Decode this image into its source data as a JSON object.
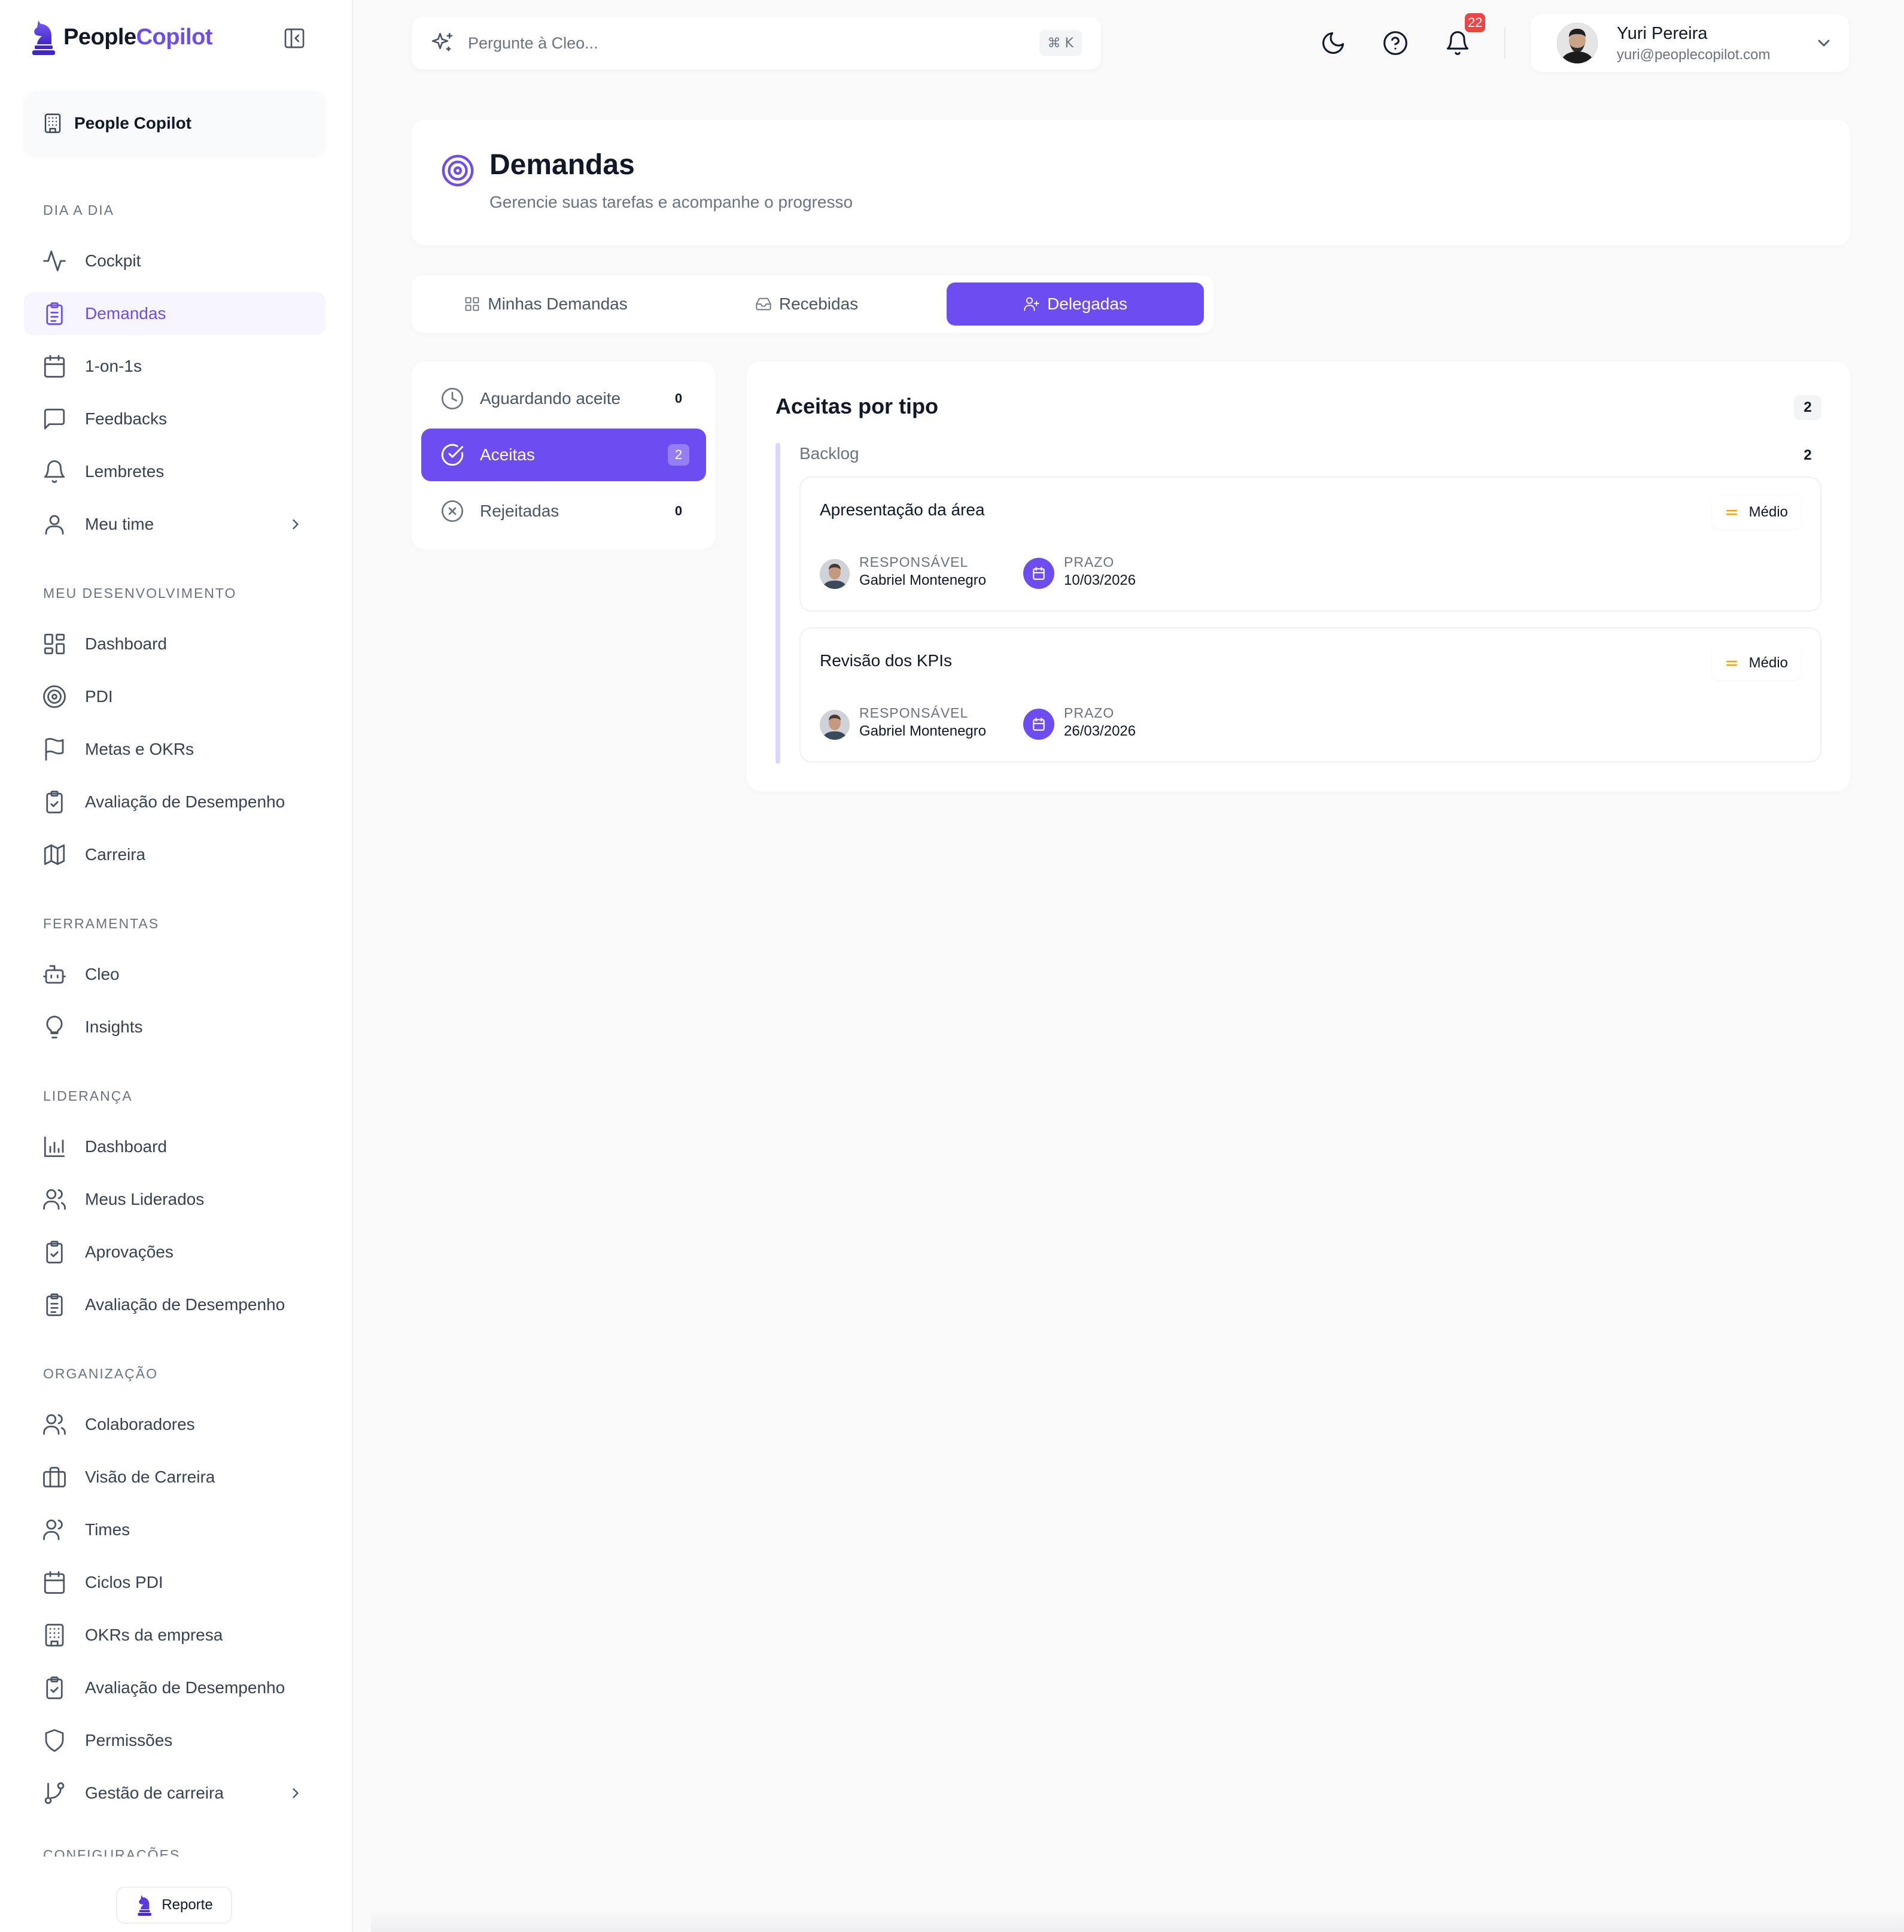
{
  "brand": {
    "name_part1": "People",
    "name_part2": "Copilot"
  },
  "org": {
    "label": "People Copilot"
  },
  "sections": {
    "dia_a_dia": "DIA A DIA",
    "meu_desenvolvimento": "MEU DESENVOLVIMENTO",
    "ferramentas": "FERRAMENTAS",
    "lideranca": "LIDERANÇA",
    "organizacao": "ORGANIZAÇÃO",
    "configuracoes": "CONFIGURAÇÕES"
  },
  "nav": {
    "dia_a_dia": [
      {
        "label": "Cockpit",
        "icon": "activity-icon"
      },
      {
        "label": "Demandas",
        "icon": "clipboard-list-icon",
        "active": true
      },
      {
        "label": "1-on-1s",
        "icon": "calendar-icon"
      },
      {
        "label": "Feedbacks",
        "icon": "message-square-icon"
      },
      {
        "label": "Lembretes",
        "icon": "bell-icon"
      },
      {
        "label": "Meu time",
        "icon": "user-icon"
      }
    ],
    "meu_desenvolvimento": [
      {
        "label": "Dashboard",
        "icon": "layout-grid-icon"
      },
      {
        "label": "PDI",
        "icon": "target-icon"
      },
      {
        "label": "Metas e OKRs",
        "icon": "flag-icon"
      },
      {
        "label": "Avaliação de Desempenho",
        "icon": "clipboard-check-icon"
      },
      {
        "label": "Carreira",
        "icon": "map-icon"
      }
    ],
    "ferramentas": [
      {
        "label": "Cleo",
        "icon": "bot-icon"
      },
      {
        "label": "Insights",
        "icon": "lightbulb-icon"
      }
    ],
    "lideranca": [
      {
        "label": "Dashboard",
        "icon": "bar-chart-icon"
      },
      {
        "label": "Meus Liderados",
        "icon": "users-icon"
      },
      {
        "label": "Aprovações",
        "icon": "clipboard-check-icon"
      },
      {
        "label": "Avaliação de Desempenho",
        "icon": "clipboard-list-icon"
      }
    ],
    "organizacao": [
      {
        "label": "Colaboradores",
        "icon": "users-icon"
      },
      {
        "label": "Visão de Carreira",
        "icon": "briefcase-icon"
      },
      {
        "label": "Times",
        "icon": "users-icon"
      },
      {
        "label": "Ciclos PDI",
        "icon": "calendar-icon"
      },
      {
        "label": "OKRs da empresa",
        "icon": "building-icon"
      },
      {
        "label": "Avaliação de Desempenho",
        "icon": "clipboard-check-icon"
      },
      {
        "label": "Permissões",
        "icon": "shield-icon"
      },
      {
        "label": "Gestão de carreira",
        "icon": "git-branch-icon"
      }
    ]
  },
  "report": {
    "label": "Reporte"
  },
  "search": {
    "placeholder": "Pergunte à Cleo...",
    "shortcut": "⌘ K"
  },
  "notifications": {
    "count": "22"
  },
  "user": {
    "name": "Yuri Pereira",
    "email": "yuri@peoplecopilot.com"
  },
  "page": {
    "title": "Demandas",
    "subtitle": "Gerencie suas tarefas e acompanhe o progresso"
  },
  "tabs": [
    {
      "label": "Minhas Demandas",
      "icon": "layout-grid-icon"
    },
    {
      "label": "Recebidas",
      "icon": "inbox-icon"
    },
    {
      "label": "Delegadas",
      "icon": "user-plus-icon",
      "active": true
    }
  ],
  "status_filters": [
    {
      "label": "Aguardando aceite",
      "count": "0",
      "icon": "clock-icon"
    },
    {
      "label": "Aceitas",
      "count": "2",
      "icon": "check-circle-icon",
      "active": true
    },
    {
      "label": "Rejeitadas",
      "count": "0",
      "icon": "x-circle-icon"
    }
  ],
  "panel": {
    "title": "Aceitas por tipo",
    "total": "2",
    "group": {
      "name": "Backlog",
      "count": "2"
    },
    "tasks": [
      {
        "title": "Apresentação da área",
        "priority": "Médio",
        "responsavel_label": "RESPONSÁVEL",
        "responsavel": "Gabriel Montenegro",
        "prazo_label": "PRAZO",
        "prazo": "10/03/2026"
      },
      {
        "title": "Revisão dos KPIs",
        "priority": "Médio",
        "responsavel_label": "RESPONSÁVEL",
        "responsavel": "Gabriel Montenegro",
        "prazo_label": "PRAZO",
        "prazo": "26/03/2026"
      }
    ]
  },
  "colors": {
    "accent": "#6d4cf0",
    "badge": "#ef4444",
    "priority_medium": "#f59e0b"
  }
}
